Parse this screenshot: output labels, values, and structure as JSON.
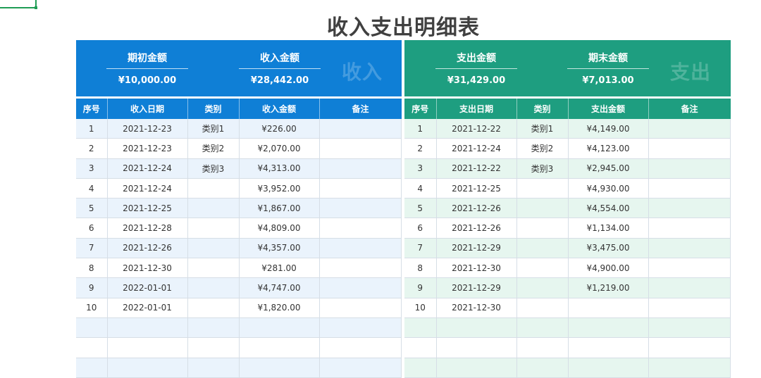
{
  "sheet_title": "收入支出明细表",
  "income": {
    "watermark": "收入",
    "kpis": [
      {
        "label": "期初金额",
        "value": "¥10,000.00"
      },
      {
        "label": "收入金额",
        "value": "¥28,442.00"
      }
    ],
    "columns": [
      "序号",
      "收入日期",
      "类别",
      "收入金额",
      "备注"
    ],
    "rows": [
      [
        "1",
        "2021-12-23",
        "类别1",
        "¥226.00",
        ""
      ],
      [
        "2",
        "2021-12-23",
        "类别2",
        "¥2,070.00",
        ""
      ],
      [
        "3",
        "2021-12-24",
        "类别3",
        "¥4,313.00",
        ""
      ],
      [
        "4",
        "2021-12-24",
        "",
        "¥3,952.00",
        ""
      ],
      [
        "5",
        "2021-12-25",
        "",
        "¥1,867.00",
        ""
      ],
      [
        "6",
        "2021-12-28",
        "",
        "¥4,809.00",
        ""
      ],
      [
        "7",
        "2021-12-26",
        "",
        "¥4,357.00",
        ""
      ],
      [
        "8",
        "2021-12-30",
        "",
        "¥281.00",
        ""
      ],
      [
        "9",
        "2022-01-01",
        "",
        "¥4,747.00",
        ""
      ],
      [
        "10",
        "2022-01-01",
        "",
        "¥1,820.00",
        ""
      ],
      [
        "",
        "",
        "",
        "",
        ""
      ],
      [
        "",
        "",
        "",
        "",
        ""
      ],
      [
        "",
        "",
        "",
        "",
        ""
      ]
    ]
  },
  "expense": {
    "watermark": "支出",
    "kpis": [
      {
        "label": "支出金额",
        "value": "¥31,429.00"
      },
      {
        "label": "期末金额",
        "value": "¥7,013.00"
      }
    ],
    "columns": [
      "序号",
      "支出日期",
      "类别",
      "支出金额",
      "备注"
    ],
    "rows": [
      [
        "1",
        "2021-12-22",
        "类别1",
        "¥4,149.00",
        ""
      ],
      [
        "2",
        "2021-12-24",
        "类别2",
        "¥4,123.00",
        ""
      ],
      [
        "3",
        "2021-12-22",
        "类别3",
        "¥2,945.00",
        ""
      ],
      [
        "4",
        "2021-12-25",
        "",
        "¥4,930.00",
        ""
      ],
      [
        "5",
        "2021-12-26",
        "",
        "¥4,554.00",
        ""
      ],
      [
        "6",
        "2021-12-26",
        "",
        "¥1,134.00",
        ""
      ],
      [
        "7",
        "2021-12-29",
        "",
        "¥3,475.00",
        ""
      ],
      [
        "8",
        "2021-12-30",
        "",
        "¥4,900.00",
        ""
      ],
      [
        "9",
        "2021-12-29",
        "",
        "¥1,219.00",
        ""
      ],
      [
        "10",
        "2021-12-30",
        "",
        "",
        ""
      ],
      [
        "",
        "",
        "",
        "",
        ""
      ],
      [
        "",
        "",
        "",
        "",
        ""
      ],
      [
        "",
        "",
        "",
        "",
        ""
      ]
    ]
  }
}
